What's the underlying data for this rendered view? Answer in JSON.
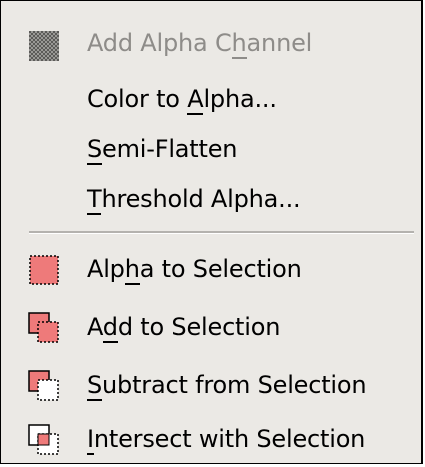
{
  "menu": {
    "items": [
      {
        "pre": "Add Alpha C",
        "mn": "h",
        "post": "annel",
        "enabled": false,
        "icon": "checkerboard-icon"
      },
      {
        "pre": "Color to ",
        "mn": "A",
        "post": "lpha...",
        "enabled": true,
        "icon": ""
      },
      {
        "pre": "",
        "mn": "S",
        "post": "emi-Flatten",
        "enabled": true,
        "icon": ""
      },
      {
        "pre": "",
        "mn": "T",
        "post": "hreshold Alpha...",
        "enabled": true,
        "icon": ""
      },
      {
        "pre": "Alp",
        "mn": "h",
        "post": "a to Selection",
        "enabled": true,
        "icon": "alpha-selection-icon"
      },
      {
        "pre": "A",
        "mn": "d",
        "post": "d to Selection",
        "enabled": true,
        "icon": "add-selection-icon"
      },
      {
        "pre": "",
        "mn": "S",
        "post": "ubtract from Selection",
        "enabled": true,
        "icon": "subtract-selection-icon"
      },
      {
        "pre": "",
        "mn": "I",
        "post": "ntersect with Selection",
        "enabled": true,
        "icon": "intersect-selection-icon"
      }
    ]
  },
  "colors": {
    "menu_background": "#ebe9e5",
    "text": "#000000",
    "disabled_text": "#8e8c89",
    "selection_fill": "#ee7a7a"
  }
}
